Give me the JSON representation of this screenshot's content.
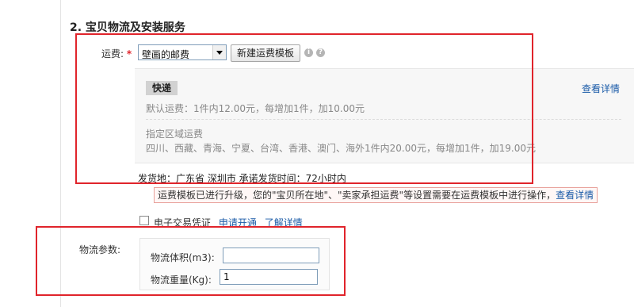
{
  "section": {
    "title": "2. 宝贝物流及安装服务"
  },
  "shipping": {
    "label": "运费:",
    "required_mark": "*",
    "template_select": {
      "value": "壁画的邮费"
    },
    "new_template_button": "新建运费模板",
    "info_icon": "i",
    "help_icon": "?",
    "delivery_type": "快递",
    "view_details": "查看详情",
    "default_fee": "默认运费：1件内12.00元，每增加1件，加10.00元",
    "region_heading": "指定区域运费",
    "region_fee": "四川、西藏、青海、宁夏、台湾、香港、澳门、海外1件内20.00元，每增加1件，加19.00元",
    "origin": "发货地：广东省 深圳市 承诺发货时间：72小时内",
    "upgrade_notice": "运费模板已进行升级，您的\"宝贝所在地\"、\"卖家承担运费\"等设置需要在运费模板中进行操作，",
    "upgrade_notice_link": "查看详情"
  },
  "e_receipt": {
    "label": "电子交易凭证",
    "apply_link": "申请开通",
    "learn_link": "了解详情"
  },
  "logistics": {
    "label": "物流参数:",
    "volume_label": "物流体积(m3):",
    "volume_value": "",
    "weight_label": "物流重量(Kg):",
    "weight_value": "1"
  },
  "colors": {
    "highlight_border": "#e0242b",
    "link": "#1a5ba8",
    "required": "#e0242b"
  }
}
